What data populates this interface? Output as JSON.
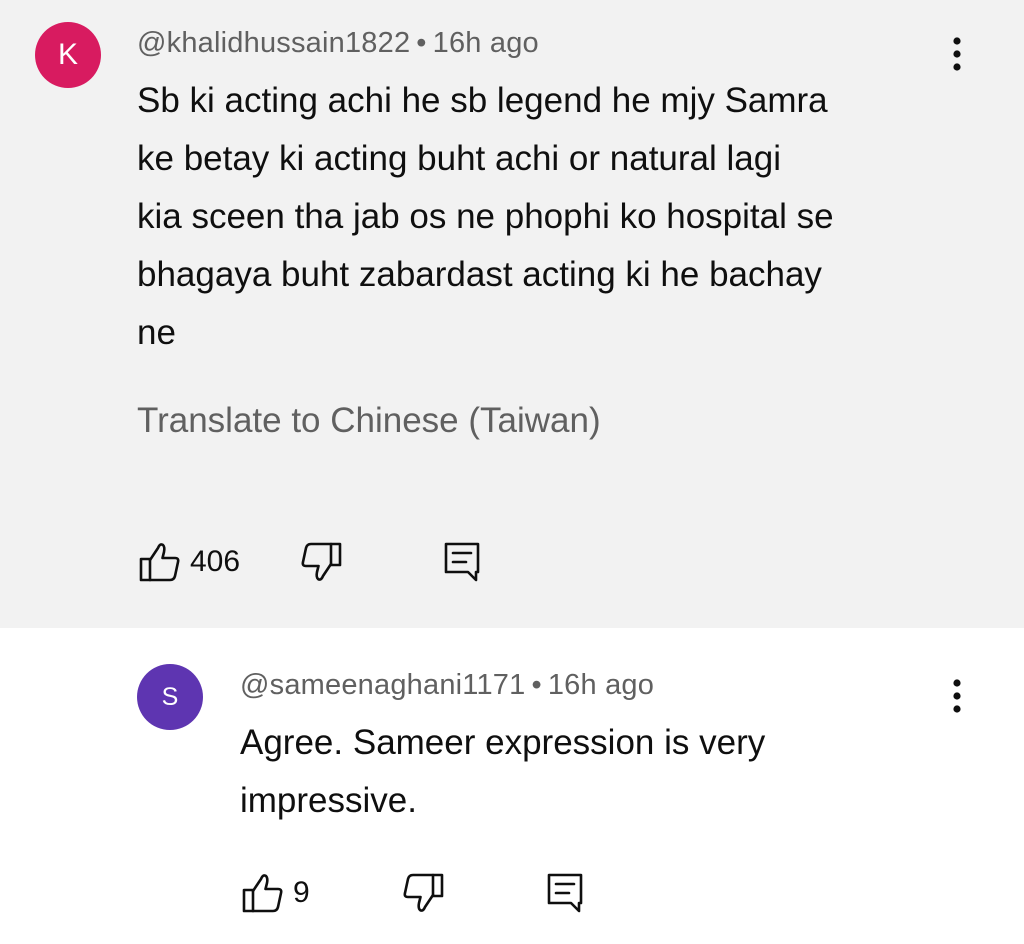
{
  "comments": [
    {
      "avatar_letter": "K",
      "avatar_color": "#d81b60",
      "handle": "@khalidhussain1822",
      "separator": "•",
      "time": "16h ago",
      "text_lines": [
        "Sb ki acting achi he sb legend he mjy Samra",
        "ke betay ki acting buht achi or natural lagi",
        "kia sceen tha jab os ne phophi ko hospital se",
        "bhagaya buht zabardast acting ki he bachay",
        "ne"
      ],
      "translate_label": "Translate to Chinese (Taiwan)",
      "like_count": "406",
      "menu_icon": "more-vert-icon",
      "like_icon": "thumb-up-icon",
      "dislike_icon": "thumb-down-icon",
      "reply_icon": "reply-comment-icon"
    },
    {
      "avatar_letter": "S",
      "avatar_color": "#5e35b1",
      "handle": "@sameenaghani1171",
      "separator": "•",
      "time": "16h ago",
      "text_lines": [
        "Agree. Sameer expression is very",
        "impressive."
      ],
      "like_count": "9",
      "menu_icon": "more-vert-icon",
      "like_icon": "thumb-up-icon",
      "dislike_icon": "thumb-down-icon",
      "reply_icon": "reply-comment-icon"
    }
  ],
  "colors": {
    "main_background": "#f2f2f2",
    "reply_background": "#ffffff",
    "secondary_text": "#606060",
    "primary_text": "#0f0f0f"
  }
}
